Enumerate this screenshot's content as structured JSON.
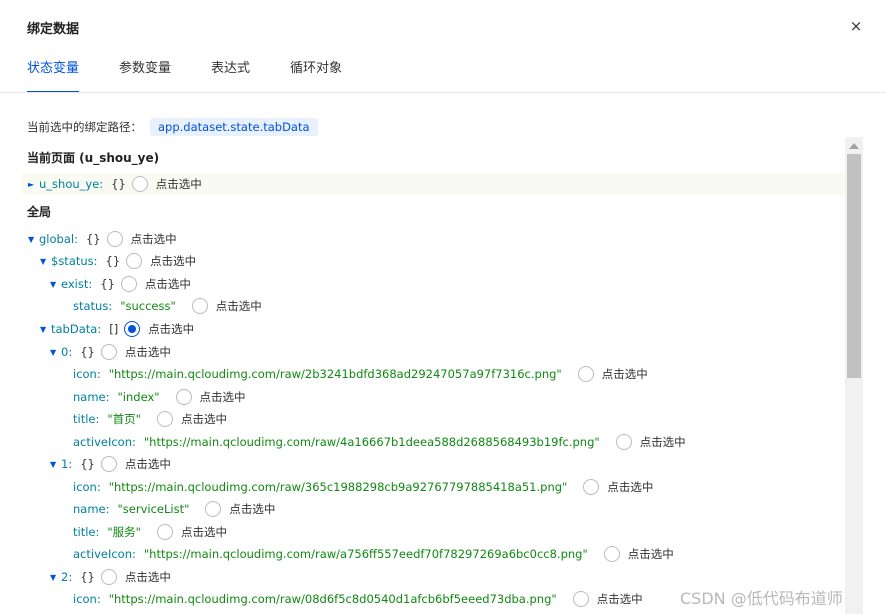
{
  "dialog": {
    "title": "绑定数据",
    "close_glyph": "×"
  },
  "tabs": [
    {
      "label": "状态变量",
      "active": true
    },
    {
      "label": "参数变量",
      "active": false
    },
    {
      "label": "表达式",
      "active": false
    },
    {
      "label": "循环对象",
      "active": false
    }
  ],
  "path": {
    "label": "当前选中的绑定路径：",
    "value": "app.dataset.state.tabData"
  },
  "sections": {
    "page": "当前页面 (u_shou_ye)",
    "global": "全局"
  },
  "select_label": "点击选中",
  "tree": {
    "u_shou_ye": {
      "key": "u_shou_ye",
      "value": "{}"
    },
    "global": {
      "key": "global",
      "value": "{}"
    },
    "status_node": {
      "key": "$status",
      "value": "{}"
    },
    "exist": {
      "key": "exist",
      "value": "{}"
    },
    "status": {
      "key": "status",
      "value": "\"success\""
    },
    "tabData": {
      "key": "tabData",
      "value": "[]"
    },
    "items": [
      {
        "key": "0",
        "value": "{}",
        "icon": "\"https://main.qcloudimg.com/raw/2b3241bdfd368ad29247057a97f7316c.png\"",
        "name": "\"index\"",
        "title": "\"首页\"",
        "activeIcon": "\"https://main.qcloudimg.com/raw/4a16667b1deea588d2688568493b19fc.png\""
      },
      {
        "key": "1",
        "value": "{}",
        "icon": "\"https://main.qcloudimg.com/raw/365c1988298cb9a92767797885418a51.png\"",
        "name": "\"serviceList\"",
        "title": "\"服务\"",
        "activeIcon": "\"https://main.qcloudimg.com/raw/a756ff557eedf70f78297269a6bc0cc8.png\""
      },
      {
        "key": "2",
        "value": "{}",
        "icon": "\"https://main.qcloudimg.com/raw/08d6f5c8d0540d1afcb6bf5eeed73dba.png\""
      }
    ],
    "field_keys": {
      "icon": "icon",
      "name": "name",
      "title": "title",
      "activeIcon": "activeIcon"
    }
  },
  "selected_path": "app.dataset.state.tabData",
  "watermark": "CSDN @低代码布道师",
  "colors": {
    "accent": "#0052d9",
    "key": "#0080a0",
    "string": "#118811"
  }
}
